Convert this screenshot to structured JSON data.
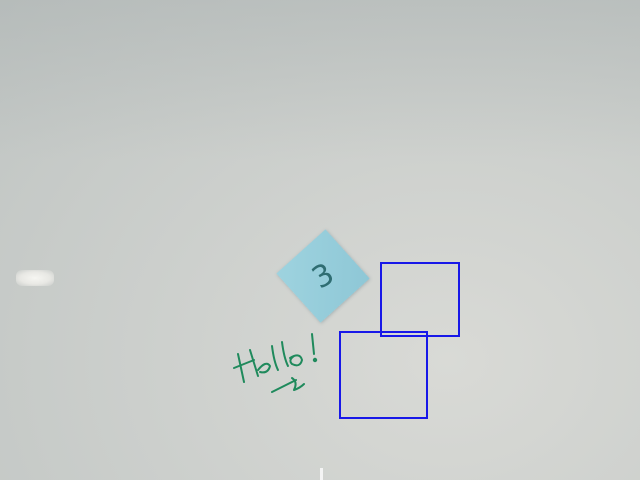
{
  "scene": {
    "surface": "whiteboard",
    "colors": {
      "board": "#cdd0cd",
      "sticky_note": "#96cddb",
      "marker_ink": "#1f8a5c",
      "detection_box": "#1818e8"
    }
  },
  "sticky_note": {
    "label": "3"
  },
  "handwriting": {
    "ink": "green marker"
  },
  "detections": [
    {
      "id": "box-a"
    },
    {
      "id": "box-b"
    }
  ]
}
